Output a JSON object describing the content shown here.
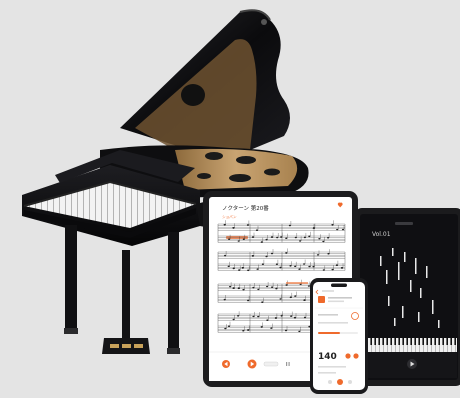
{
  "colors": {
    "background": "#e4e4e4",
    "piano_black": "#0d0d0f",
    "wood": "#c9a472",
    "accent": "#ef6a2c",
    "screen_dark": "#0f0f12"
  },
  "tablet": {
    "title": "ノクターン 第20番",
    "subtitle": "ショパン"
  },
  "phone": {
    "tempo": "140"
  },
  "dark_tablet": {
    "title": "Vol.01"
  },
  "icons": {
    "tablet_marker": "heart-icon",
    "phone_back": "chevron-left-icon",
    "play": "play-icon",
    "rewind": "rewind-icon"
  }
}
